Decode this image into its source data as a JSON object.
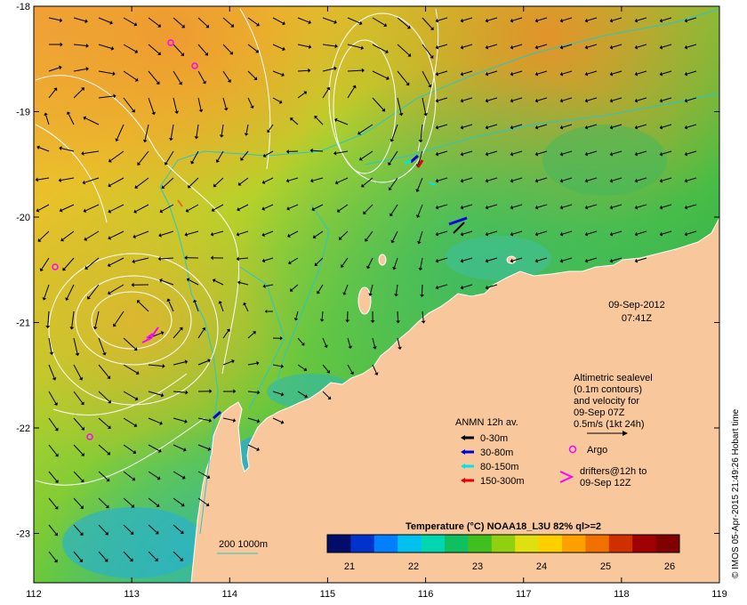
{
  "map": {
    "lon_labels": [
      "112",
      "113",
      "114",
      "115",
      "116",
      "117",
      "118",
      "119"
    ],
    "lat_labels": [
      "-18",
      "-19",
      "-20",
      "-21",
      "-22",
      "-23"
    ],
    "date": "09-Sep-2012",
    "time": "07:41Z",
    "credit": "© IMOS 05-Apr-2015 21:49:26 Hobart time",
    "land_color": "#f8c89c",
    "contour_color": "#ffffff",
    "isobath_color": "#26c7c7"
  },
  "legend_sealevel": {
    "line1": "Altimetric sealevel",
    "line2": "(0.1m contours)",
    "line3": "and velocity for",
    "line4": "09-Sep 07Z",
    "line5": "0.5m/s (1kt 24h)"
  },
  "legend_anmn": {
    "title": "ANMN 12h av.",
    "items": [
      {
        "label": "0-30m",
        "color": "#000000"
      },
      {
        "label": "30-80m",
        "color": "#0000e0"
      },
      {
        "label": "80-150m",
        "color": "#00e6e6"
      },
      {
        "label": "150-300m",
        "color": "#e00000"
      }
    ]
  },
  "legend_argo": {
    "label": "Argo",
    "color": "#ff00ff"
  },
  "legend_drifters": {
    "line1": "drifters@12h to",
    "line2": "09-Sep 12Z",
    "color": "#ff00ff"
  },
  "isobath_label": "200  1000m",
  "colorbar": {
    "title": "Temperature (°C) NOAA18_L3U 82% ql>=2",
    "ticks": [
      "21",
      "22",
      "23",
      "24",
      "25",
      "26"
    ],
    "colors": [
      "#000d6b",
      "#0033cc",
      "#0080ff",
      "#00c0f0",
      "#00d6b0",
      "#10c060",
      "#40c020",
      "#90d010",
      "#e0e010",
      "#ffd000",
      "#ffa000",
      "#f07000",
      "#d03000",
      "#a00000",
      "#800000"
    ]
  }
}
